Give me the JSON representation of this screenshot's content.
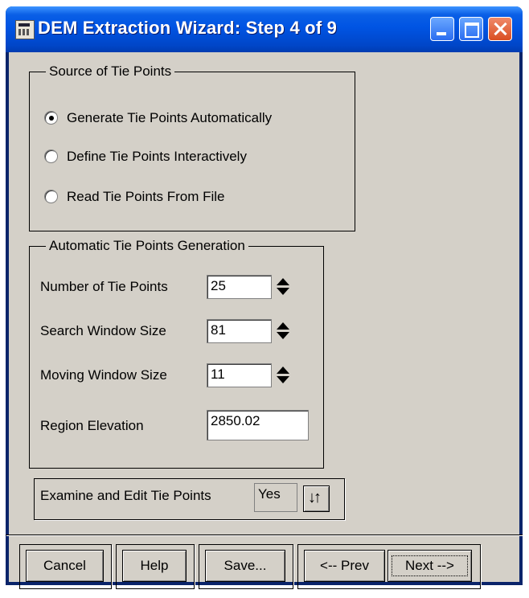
{
  "window": {
    "title": "DEM Extraction Wizard: Step 4 of 9"
  },
  "source_group": {
    "label": "Source of Tie Points",
    "options": [
      {
        "label": "Generate Tie Points Automatically",
        "checked": true
      },
      {
        "label": "Define Tie Points Interactively",
        "checked": false
      },
      {
        "label": "Read Tie Points From File",
        "checked": false
      }
    ]
  },
  "auto_group": {
    "label": "Automatic Tie Points Generation",
    "fields": [
      {
        "label": "Number of Tie Points",
        "value": "25"
      },
      {
        "label": "Search Window Size",
        "value": "81"
      },
      {
        "label": "Moving Window Size",
        "value": "11"
      },
      {
        "label": "Region Elevation",
        "value": "2850.02"
      }
    ]
  },
  "examine": {
    "label": "Examine and Edit Tie Points",
    "value": "Yes",
    "toggle_icon": "up-down-arrows-icon"
  },
  "buttons": {
    "cancel": "Cancel",
    "help": "Help",
    "save": "Save...",
    "prev": "<-- Prev",
    "next": "Next -->"
  },
  "colors": {
    "titlebar": "#0054e3",
    "client": "#d4d0c8",
    "close_button": "#d94e22"
  }
}
